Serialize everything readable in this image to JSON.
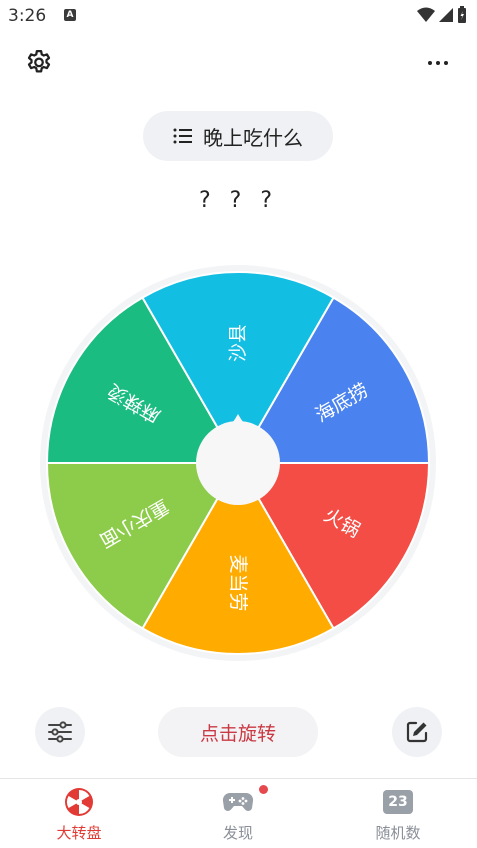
{
  "status_bar": {
    "time": "3:26",
    "app_icon_letter": "A"
  },
  "header": {
    "settings_icon": "gear-icon",
    "more_icon": "more-icon"
  },
  "title_chip": {
    "icon": "list-icon",
    "label": "晚上吃什么"
  },
  "result_text": "? ? ?",
  "wheel": {
    "segments": [
      {
        "label": "海底捞",
        "color": "#4a83ef"
      },
      {
        "label": "火锅",
        "color": "#f44d45"
      },
      {
        "label": "麦当劳",
        "color": "#ffab00"
      },
      {
        "label": "重庆小面",
        "color": "#8ccc4a"
      },
      {
        "label": "麻辣烫",
        "color": "#1bbc81"
      },
      {
        "label": "沙县",
        "color": "#12bee2"
      }
    ]
  },
  "controls": {
    "spin_label": "点击旋转",
    "adjust_icon": "sliders-icon",
    "edit_icon": "edit-icon"
  },
  "tabs": [
    {
      "label": "大转盘",
      "icon": "wheel-icon",
      "active": true
    },
    {
      "label": "发现",
      "icon": "gamepad-icon",
      "active": false
    },
    {
      "label": "随机数",
      "icon": "number-icon",
      "icon_text": "23",
      "active": false
    }
  ],
  "colors": {
    "accent": "#e23b35",
    "inactive": "#8a8f98"
  }
}
